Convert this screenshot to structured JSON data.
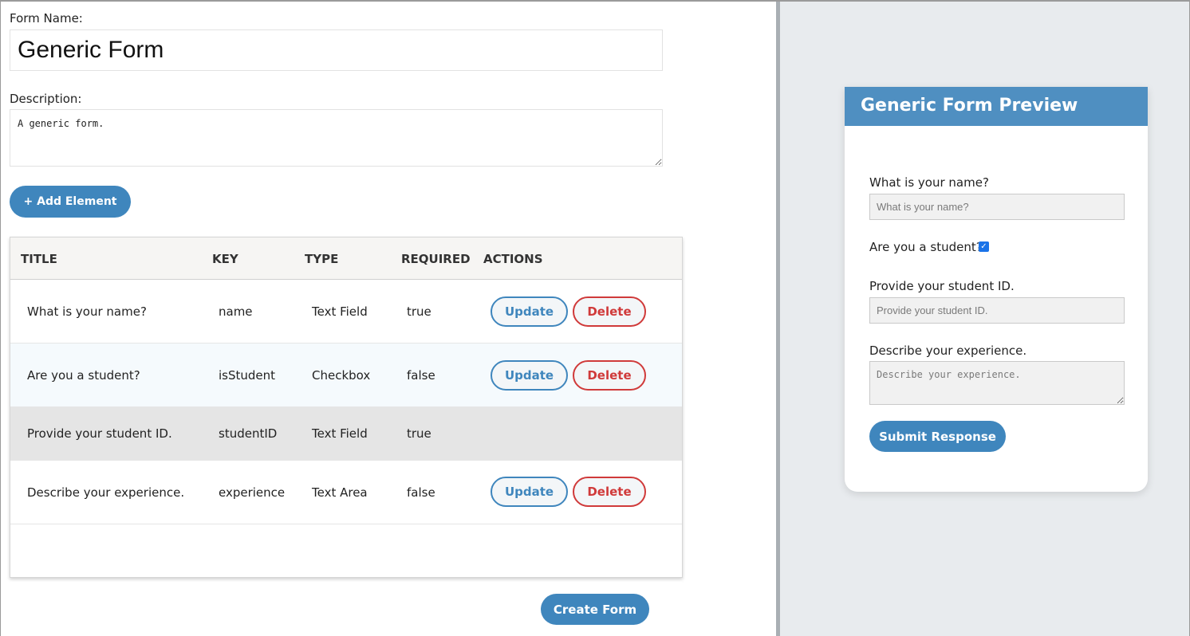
{
  "builder": {
    "form_name_label": "Form Name:",
    "form_name_value": "Generic Form",
    "description_label": "Description:",
    "description_value": "A generic form.",
    "add_element_label": "+ Add Element",
    "create_form_label": "Create Form"
  },
  "table": {
    "headers": [
      "TITLE",
      "KEY",
      "TYPE",
      "REQUIRED",
      "ACTIONS"
    ],
    "rows": [
      {
        "title": "What is your name?",
        "key": "name",
        "type": "Text Field",
        "required": "true",
        "update": "Update",
        "delete": "Delete"
      },
      {
        "title": "Are you a student?",
        "key": "isStudent",
        "type": "Checkbox",
        "required": "false",
        "update": "Update",
        "delete": "Delete"
      },
      {
        "title": "Provide your student ID.",
        "key": "studentID",
        "type": "Text Field",
        "required": "true"
      },
      {
        "title": "Describe your experience.",
        "key": "experience",
        "type": "Text Area",
        "required": "false",
        "update": "Update",
        "delete": "Delete"
      }
    ]
  },
  "preview": {
    "title": "Generic Form Preview",
    "q1_label": "What is your name?",
    "q1_placeholder": "What is your name?",
    "q2_label": "Are you a student?",
    "q2_checked": true,
    "q3_label": "Provide your student ID.",
    "q3_placeholder": "Provide your student ID.",
    "q4_label": "Describe your experience.",
    "q4_placeholder": "Describe your experience.",
    "submit_label": "Submit Response"
  },
  "colors": {
    "primary": "#3f86bd",
    "danger": "#d03a3a",
    "preview_header": "#4f8fc1",
    "right_panel_bg": "#e8ebee",
    "highlight_row": "#f5fafd",
    "disabled_row": "#e5e5e5"
  }
}
